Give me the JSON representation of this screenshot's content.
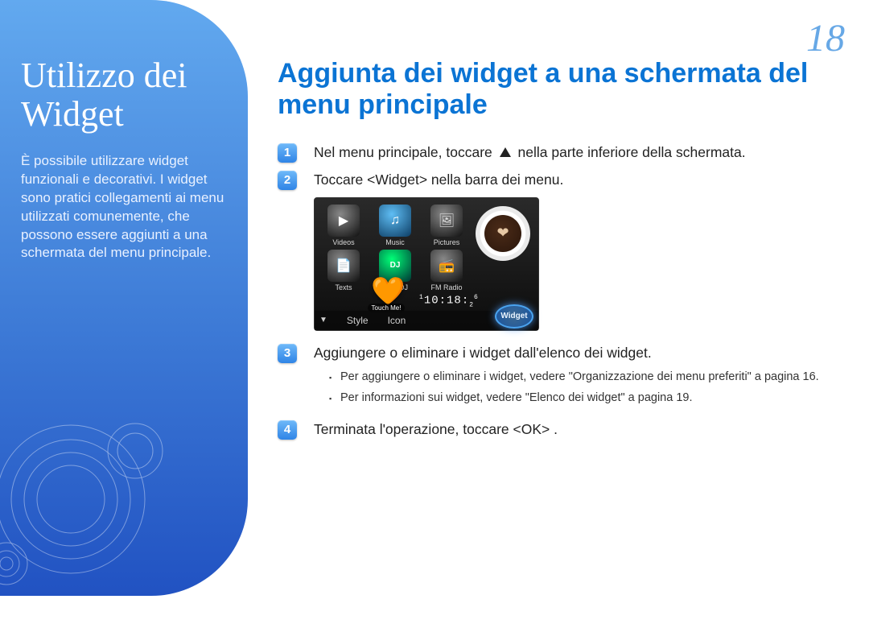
{
  "page_number": "18",
  "sidebar": {
    "title": "Utilizzo dei Widget",
    "description": "È possibile utilizzare widget funzionali e decorativi. I widget sono pratici collegamenti ai menu utilizzati comunemente, che possono essere aggiunti a una schermata del menu principale."
  },
  "section": {
    "title": "Aggiunta dei widget a una schermata del menu principale"
  },
  "steps": {
    "s1_num": "1",
    "s1_a": "Nel menu principale, toccare ",
    "s1_b": " nella parte inferiore della schermata.",
    "s2_num": "2",
    "s2": "Toccare <Widget> nella barra dei menu.",
    "s3_num": "3",
    "s3": "Aggiungere o eliminare i widget dall'elenco dei widget.",
    "s3_sub1": "Per aggiungere o eliminare i widget, vedere \"Organizzazione dei menu preferiti\" a pagina 16.",
    "s3_sub2": "Per informazioni sui widget, vedere \"Elenco dei widget\" a pagina 19.",
    "s4_num": "4",
    "s4": "Terminata l'operazione, toccare <OK> ."
  },
  "device": {
    "apps": {
      "videos": "Videos",
      "music": "Music",
      "pictures": "Pictures",
      "texts": "Texts",
      "beatdj": "Beat DJ",
      "fmradio": "FM Radio"
    },
    "touch_me": "Touch Me!",
    "clock": "10:18:",
    "bar": {
      "style": "Style",
      "icon": "Icon",
      "widget": "Widget"
    }
  }
}
